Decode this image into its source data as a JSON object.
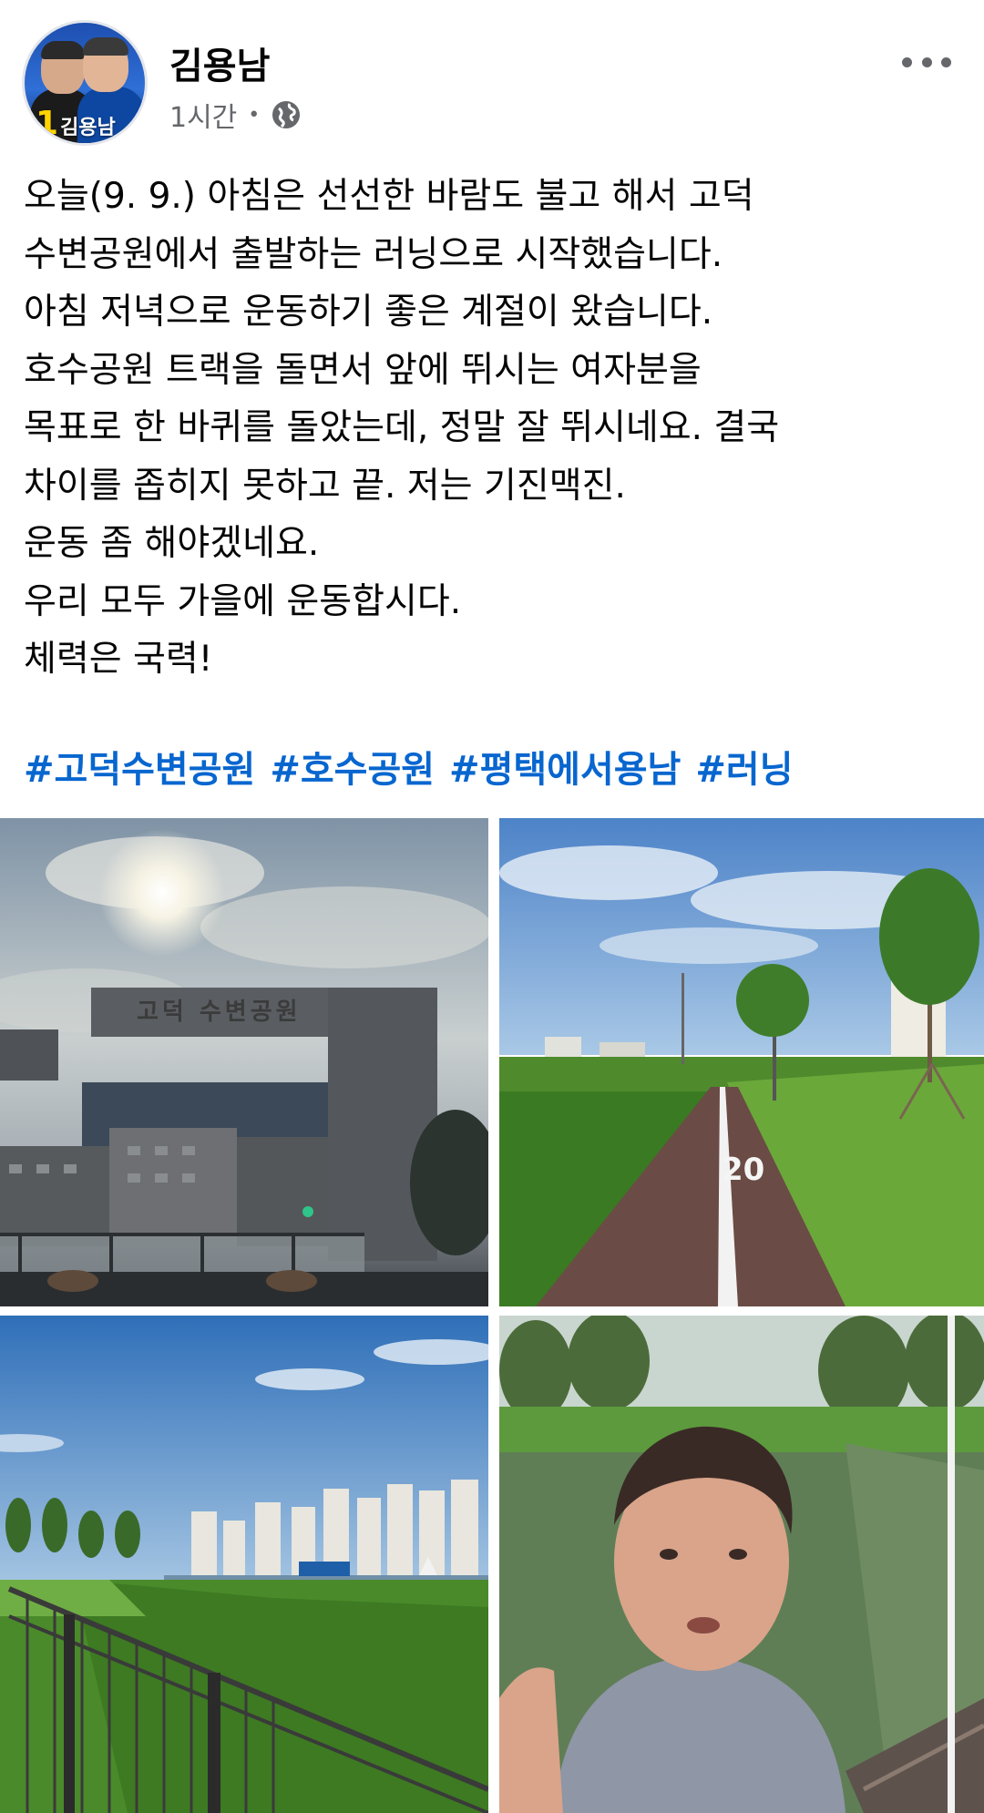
{
  "post": {
    "author_name": "김용남",
    "avatar_badge_number": "1",
    "avatar_badge_name": "김용남",
    "timestamp": "1시간",
    "separator": "•",
    "privacy_icon": "globe-icon",
    "menu_icon": "more-options-icon",
    "body_lines": [
      "오늘(9. 9.) 아침은 선선한 바람도 불고 해서 고덕",
      "수변공원에서 출발하는 러닝으로 시작했습니다.",
      "아침 저녁으로 운동하기 좋은 계절이 왔습니다.",
      "호수공원 트랙을 돌면서 앞에 뛰시는 여자분을",
      "목표로 한 바퀴를 돌았는데, 정말 잘 뛰시네요. 결국",
      "차이를 좁히지 못하고 끝. 저는 기진맥진.",
      "운동 좀 해야겠네요.",
      "우리 모두 가을에 운동합시다.",
      "체력은 국력!"
    ],
    "hashtags": [
      "#고덕수변공원",
      "#호수공원",
      "#평택에서용남",
      "#러닝"
    ],
    "photos": {
      "photo1_sign": "고덕 수변공원",
      "photo2_marking": "20"
    },
    "colors": {
      "hashtag": "#0866cf",
      "meta_text": "#65676b"
    }
  }
}
